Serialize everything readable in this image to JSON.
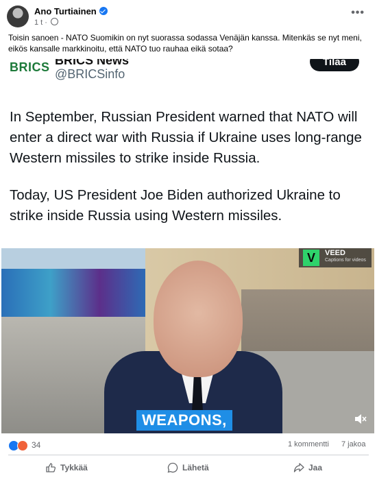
{
  "post": {
    "author": "Ano Turtiainen",
    "time": "1 t",
    "more_label": "•••",
    "caption": "Toisin sanoen - NATO Suomikin on nyt suorassa sodassa Venäjän kanssa. Mitenkäs se nyt meni, eikös kansalle markkinoitu, että NATO tuo rauhaa eikä sotaa?"
  },
  "tweet": {
    "logo_text": "BRICS",
    "name": "BRICS News",
    "handle": "@BRICSinfo",
    "follow_label": "Tilaa",
    "paragraph1": "In September, Russian President warned that NATO will enter a direct war with Russia if Ukraine uses long-range Western missiles to strike inside Russia.",
    "paragraph2": "Today, US President Joe Biden authorized Ukraine to strike inside Russia using Western missiles."
  },
  "video": {
    "subtitle": "WEAPONS,",
    "watermark_name": "VEED",
    "watermark_sub": "Captions for videos",
    "watermark_letter": "V"
  },
  "stats": {
    "reaction_count": "34",
    "comments": "1 kommentti",
    "shares": "7 jakoa"
  },
  "actions": {
    "like": "Tykkää",
    "send": "Lähetä",
    "share": "Jaa"
  },
  "colors": {
    "accent": "#1877f2",
    "subtitle_bg": "#1f8ee6",
    "veed_green": "#2ed36b"
  }
}
